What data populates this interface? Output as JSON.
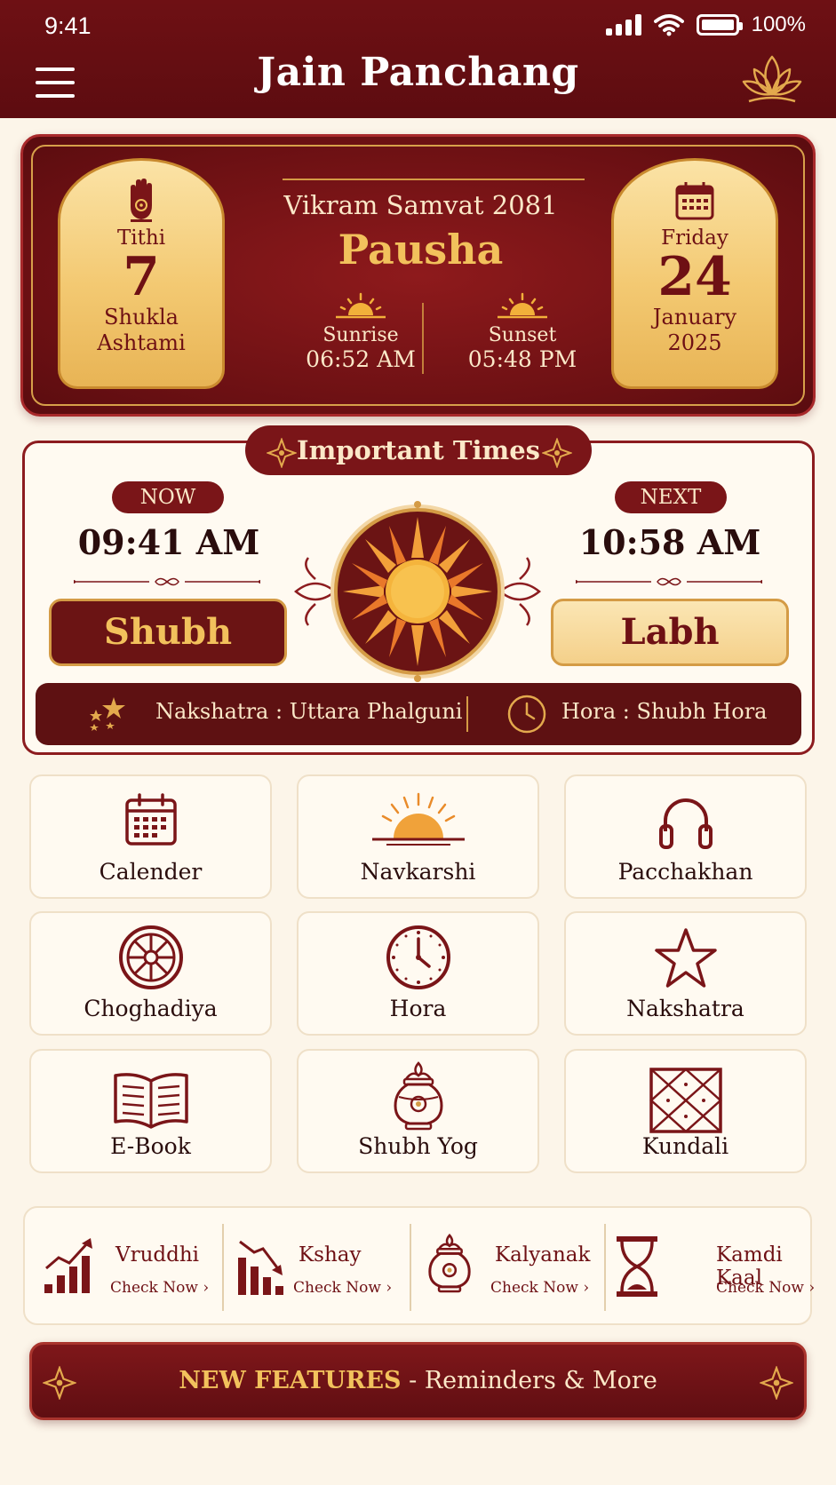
{
  "status_bar": {
    "time": "9:41",
    "battery": "100%"
  },
  "header": {
    "title": "Jain Panchang"
  },
  "date_card": {
    "tithi_label": "Tithi",
    "tithi_number": "7",
    "paksha": "Shukla",
    "tithi_name": "Ashtami",
    "samvat": "Vikram Samvat 2081",
    "month": "Pausha",
    "sunrise_label": "Sunrise",
    "sunrise_time": "06:52 AM",
    "sunset_label": "Sunset",
    "sunset_time": "05:48 PM",
    "weekday": "Friday",
    "day": "24",
    "month_name": "January",
    "year": "2025"
  },
  "important_times": {
    "title": "Important Times",
    "now_label": "NOW",
    "now_time": "09:41 AM",
    "now_slot": "Shubh",
    "next_label": "NEXT",
    "next_time": "10:58 AM",
    "next_slot": "Labh",
    "nakshatra_text": "Nakshatra : Uttara Phalguni",
    "hora_text": "Hora : Shubh Hora"
  },
  "grid": [
    {
      "label": "Calender",
      "icon": "calendar-icon"
    },
    {
      "label": "Navkarshi",
      "icon": "sunrise-icon"
    },
    {
      "label": "Pacchakhan",
      "icon": "headphones-icon"
    },
    {
      "label": "Choghadiya",
      "icon": "wheel-icon"
    },
    {
      "label": "Hora",
      "icon": "clock-icon"
    },
    {
      "label": "Nakshatra",
      "icon": "star-icon"
    },
    {
      "label": "E-Book",
      "icon": "open-book-icon"
    },
    {
      "label": "Shubh Yog",
      "icon": "kalash-icon"
    },
    {
      "label": "Kundali",
      "icon": "kundali-chart-icon"
    }
  ],
  "quick_links": [
    {
      "title": "Vruddhi",
      "cta": "Check Now",
      "icon": "growth-chart-icon"
    },
    {
      "title": "Kshay",
      "cta": "Check Now",
      "icon": "decline-chart-icon"
    },
    {
      "title": "Kalyanak",
      "cta": "Check Now",
      "icon": "kalash-icon"
    },
    {
      "title": "Kamdi Kaal",
      "cta": "Check Now",
      "icon": "hourglass-icon"
    }
  ],
  "banner": {
    "strong": "NEW FEATURES",
    "rest": " - Reminders & More"
  },
  "colors": {
    "maroon": "#7a1518",
    "gold": "#f2c15c",
    "cream": "#fcf5e9"
  }
}
